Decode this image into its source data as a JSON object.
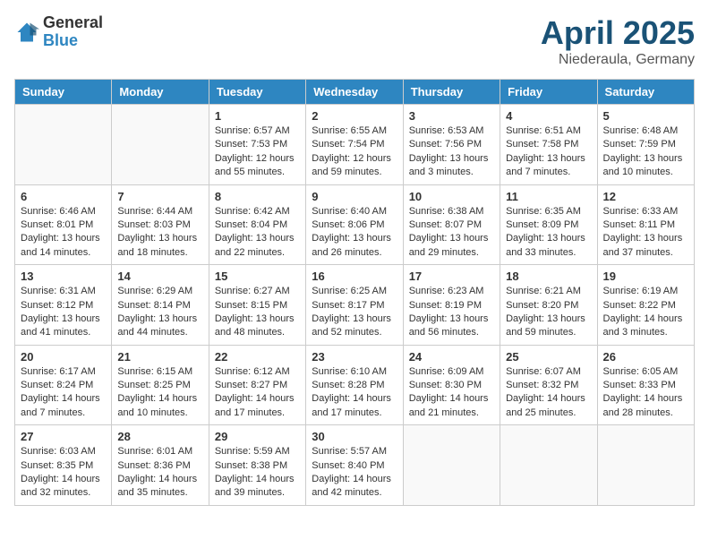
{
  "logo": {
    "general": "General",
    "blue": "Blue"
  },
  "title": "April 2025",
  "location": "Niederaula, Germany",
  "days_of_week": [
    "Sunday",
    "Monday",
    "Tuesday",
    "Wednesday",
    "Thursday",
    "Friday",
    "Saturday"
  ],
  "weeks": [
    [
      {
        "day": "",
        "info": ""
      },
      {
        "day": "",
        "info": ""
      },
      {
        "day": "1",
        "info": "Sunrise: 6:57 AM\nSunset: 7:53 PM\nDaylight: 12 hours and 55 minutes."
      },
      {
        "day": "2",
        "info": "Sunrise: 6:55 AM\nSunset: 7:54 PM\nDaylight: 12 hours and 59 minutes."
      },
      {
        "day": "3",
        "info": "Sunrise: 6:53 AM\nSunset: 7:56 PM\nDaylight: 13 hours and 3 minutes."
      },
      {
        "day": "4",
        "info": "Sunrise: 6:51 AM\nSunset: 7:58 PM\nDaylight: 13 hours and 7 minutes."
      },
      {
        "day": "5",
        "info": "Sunrise: 6:48 AM\nSunset: 7:59 PM\nDaylight: 13 hours and 10 minutes."
      }
    ],
    [
      {
        "day": "6",
        "info": "Sunrise: 6:46 AM\nSunset: 8:01 PM\nDaylight: 13 hours and 14 minutes."
      },
      {
        "day": "7",
        "info": "Sunrise: 6:44 AM\nSunset: 8:03 PM\nDaylight: 13 hours and 18 minutes."
      },
      {
        "day": "8",
        "info": "Sunrise: 6:42 AM\nSunset: 8:04 PM\nDaylight: 13 hours and 22 minutes."
      },
      {
        "day": "9",
        "info": "Sunrise: 6:40 AM\nSunset: 8:06 PM\nDaylight: 13 hours and 26 minutes."
      },
      {
        "day": "10",
        "info": "Sunrise: 6:38 AM\nSunset: 8:07 PM\nDaylight: 13 hours and 29 minutes."
      },
      {
        "day": "11",
        "info": "Sunrise: 6:35 AM\nSunset: 8:09 PM\nDaylight: 13 hours and 33 minutes."
      },
      {
        "day": "12",
        "info": "Sunrise: 6:33 AM\nSunset: 8:11 PM\nDaylight: 13 hours and 37 minutes."
      }
    ],
    [
      {
        "day": "13",
        "info": "Sunrise: 6:31 AM\nSunset: 8:12 PM\nDaylight: 13 hours and 41 minutes."
      },
      {
        "day": "14",
        "info": "Sunrise: 6:29 AM\nSunset: 8:14 PM\nDaylight: 13 hours and 44 minutes."
      },
      {
        "day": "15",
        "info": "Sunrise: 6:27 AM\nSunset: 8:15 PM\nDaylight: 13 hours and 48 minutes."
      },
      {
        "day": "16",
        "info": "Sunrise: 6:25 AM\nSunset: 8:17 PM\nDaylight: 13 hours and 52 minutes."
      },
      {
        "day": "17",
        "info": "Sunrise: 6:23 AM\nSunset: 8:19 PM\nDaylight: 13 hours and 56 minutes."
      },
      {
        "day": "18",
        "info": "Sunrise: 6:21 AM\nSunset: 8:20 PM\nDaylight: 13 hours and 59 minutes."
      },
      {
        "day": "19",
        "info": "Sunrise: 6:19 AM\nSunset: 8:22 PM\nDaylight: 14 hours and 3 minutes."
      }
    ],
    [
      {
        "day": "20",
        "info": "Sunrise: 6:17 AM\nSunset: 8:24 PM\nDaylight: 14 hours and 7 minutes."
      },
      {
        "day": "21",
        "info": "Sunrise: 6:15 AM\nSunset: 8:25 PM\nDaylight: 14 hours and 10 minutes."
      },
      {
        "day": "22",
        "info": "Sunrise: 6:12 AM\nSunset: 8:27 PM\nDaylight: 14 hours and 17 minutes."
      },
      {
        "day": "23",
        "info": "Sunrise: 6:10 AM\nSunset: 8:28 PM\nDaylight: 14 hours and 17 minutes."
      },
      {
        "day": "24",
        "info": "Sunrise: 6:09 AM\nSunset: 8:30 PM\nDaylight: 14 hours and 21 minutes."
      },
      {
        "day": "25",
        "info": "Sunrise: 6:07 AM\nSunset: 8:32 PM\nDaylight: 14 hours and 25 minutes."
      },
      {
        "day": "26",
        "info": "Sunrise: 6:05 AM\nSunset: 8:33 PM\nDaylight: 14 hours and 28 minutes."
      }
    ],
    [
      {
        "day": "27",
        "info": "Sunrise: 6:03 AM\nSunset: 8:35 PM\nDaylight: 14 hours and 32 minutes."
      },
      {
        "day": "28",
        "info": "Sunrise: 6:01 AM\nSunset: 8:36 PM\nDaylight: 14 hours and 35 minutes."
      },
      {
        "day": "29",
        "info": "Sunrise: 5:59 AM\nSunset: 8:38 PM\nDaylight: 14 hours and 39 minutes."
      },
      {
        "day": "30",
        "info": "Sunrise: 5:57 AM\nSunset: 8:40 PM\nDaylight: 14 hours and 42 minutes."
      },
      {
        "day": "",
        "info": ""
      },
      {
        "day": "",
        "info": ""
      },
      {
        "day": "",
        "info": ""
      }
    ]
  ]
}
